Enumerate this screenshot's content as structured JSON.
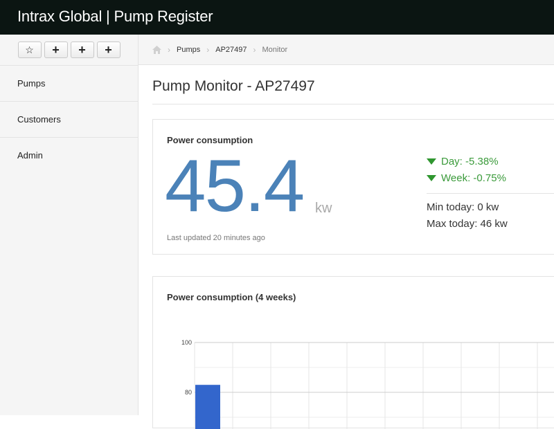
{
  "app": {
    "title": "Intrax Global | Pump Register"
  },
  "shortcuts": [
    {
      "icon": "star-icon",
      "glyph": "☆"
    },
    {
      "icon": "plus-icon",
      "glyph": "+"
    },
    {
      "icon": "plus-icon",
      "glyph": "+"
    },
    {
      "icon": "plus-icon",
      "glyph": "+"
    }
  ],
  "sidebar": {
    "items": [
      {
        "label": "Pumps"
      },
      {
        "label": "Customers"
      },
      {
        "label": "Admin"
      }
    ]
  },
  "breadcrumb": {
    "items": [
      {
        "label": "Pumps"
      },
      {
        "label": "AP27497"
      },
      {
        "label": "Monitor"
      }
    ]
  },
  "page": {
    "title": "Pump Monitor - AP27497"
  },
  "consumption": {
    "title": "Power consumption",
    "value": "45.4",
    "unit": "kw",
    "updated": "Last updated 20 minutes ago",
    "day_change": "Day: -5.38%",
    "week_change": "Week: -0.75%",
    "min_today": "Min today: 0 kw",
    "max_today": "Max today: 46 kw"
  },
  "chart_panel": {
    "title": "Power consumption (4 weeks)"
  },
  "colors": {
    "accent": "#4b82b8",
    "down": "#2f962f",
    "bar": "#3366cc"
  },
  "chart_data": {
    "type": "bar",
    "title": "Power consumption (4 weeks)",
    "xlabel": "",
    "ylabel": "",
    "ylim": [
      0,
      100
    ],
    "yticks": [
      100,
      80
    ],
    "visible_ytick_labels": [
      "100",
      "80"
    ],
    "grid": true,
    "series": [
      {
        "values": [
          83
        ]
      }
    ]
  }
}
